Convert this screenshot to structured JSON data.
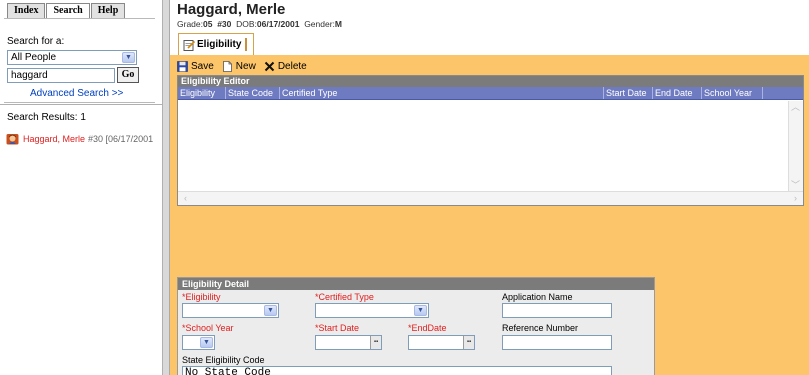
{
  "left_panel": {
    "tabs": [
      {
        "label": "Index",
        "active": false
      },
      {
        "label": "Search",
        "active": true
      },
      {
        "label": "Help",
        "active": false
      }
    ],
    "search_for_label": "Search for a:",
    "people_select_value": "All People",
    "search_value": "haggard",
    "go_label": "Go",
    "advanced_search_label": "Advanced Search >>",
    "results_count_label": "Search Results: 1",
    "result": {
      "name": "Haggard, Merle",
      "details": "#30 [06/17/2001"
    }
  },
  "header": {
    "student_name": "Haggard, Merle",
    "grade_label": "Grade:",
    "grade_value": "05",
    "id_value": "#30",
    "dob_label": "DOB:",
    "dob_value": "06/17/2001",
    "gender_label": "Gender:",
    "gender_value": "M",
    "module_tab_label": "Eligibility"
  },
  "toolbar": {
    "save_label": "Save",
    "new_label": "New",
    "delete_label": "Delete"
  },
  "editor": {
    "title": "Eligibility Editor",
    "columns": [
      "Eligibility",
      "State Code",
      "Certified Type",
      "Start Date",
      "End Date",
      "School Year"
    ]
  },
  "detail": {
    "title": "Eligibility Detail",
    "eligibility_label": "*Eligibility",
    "certified_type_label": "*Certified Type",
    "application_name_label": "Application Name",
    "school_year_label": "*School Year",
    "start_date_label": "*Start Date",
    "end_date_label": "*EndDate",
    "reference_number_label": "Reference Number",
    "state_code_label": "State Eligibility Code",
    "state_code_value": "No State Code"
  },
  "colors": {
    "work_area": "#fcc56a",
    "grid_header": "#6f7bc0",
    "panel_title": "#7b7b7b",
    "required_label": "#e02020",
    "link": "#0040c0"
  }
}
